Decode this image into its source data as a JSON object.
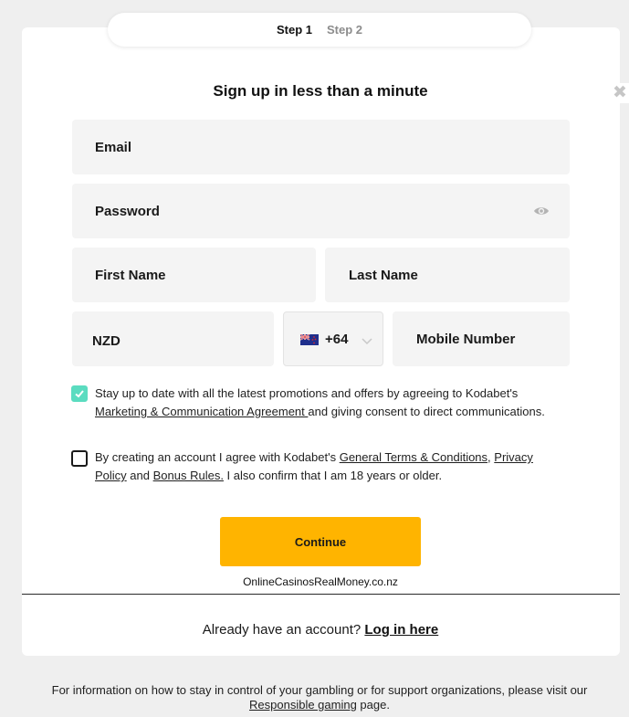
{
  "steps": {
    "step1": "Step 1",
    "step2": "Step 2"
  },
  "close_symbol": "✖",
  "title": "Sign up in less than a minute",
  "fields": {
    "email": "Email",
    "password": "Password",
    "first_name": "First Name",
    "last_name": "Last Name",
    "currency": "NZD",
    "country_code": "+64",
    "mobile": "Mobile Number"
  },
  "icons": {
    "password_toggle": "eye-icon",
    "flag": "new-zealand-flag-icon",
    "dropdown": "chevron-down-icon",
    "checkmark": "check-icon"
  },
  "consent": {
    "marketing_checked": true,
    "marketing_text_1": "Stay up to date with all the latest promotions and offers by agreeing to Kodabet's ",
    "marketing_link": "Marketing & Communication Agreement ",
    "marketing_text_2": "and giving consent to direct communications.",
    "terms_checked": false,
    "terms_text_1": "By creating an account I agree with Kodabet's ",
    "terms_link": "General Terms & Conditions",
    "terms_sep": ", ",
    "privacy_link": "Privacy Policy",
    "terms_text_2": " and ",
    "bonus_link": "Bonus Rules.",
    "terms_text_3": " I also confirm that I am 18 years or older."
  },
  "continue_label": "Continue",
  "watermark": "OnlineCasinosRealMoney.co.nz",
  "login": {
    "prompt": "Already have an account? ",
    "link": "Log in here"
  },
  "footer": {
    "text_1": "For information on how to stay in control of your gambling or for support organizations, please visit our ",
    "link": "Responsible gaming",
    "text_2": " page."
  },
  "colors": {
    "accent": "#ffb400",
    "checkbox_on": "#5bdcc0",
    "field_bg": "#f4f4f4",
    "page_bg": "#efefef"
  }
}
